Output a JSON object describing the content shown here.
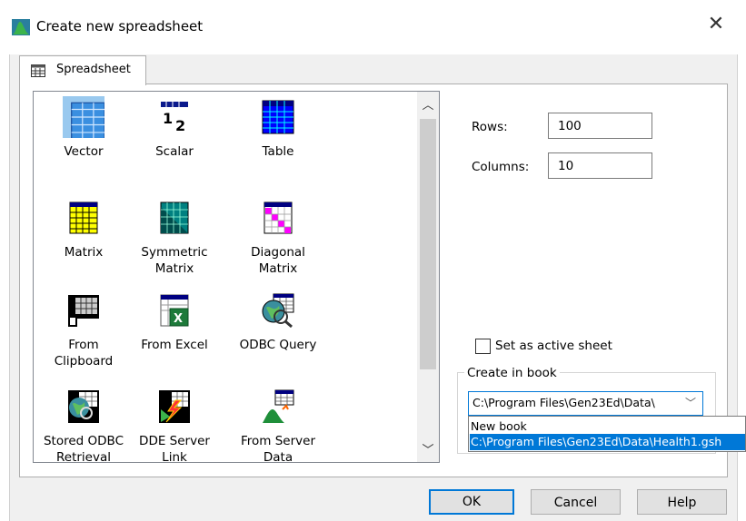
{
  "window": {
    "title": "Create new spreadsheet",
    "close_icon": "close-icon"
  },
  "tab": {
    "label": "Spreadsheet",
    "icon": "spreadsheet-grid-icon"
  },
  "types": [
    {
      "id": "vector",
      "label": "Vector",
      "icon": "vector-icon",
      "selected": true
    },
    {
      "id": "scalar",
      "label": "Scalar",
      "icon": "scalar-icon"
    },
    {
      "id": "table",
      "label": "Table",
      "icon": "table-icon"
    },
    {
      "id": "matrix",
      "label": "Matrix",
      "icon": "matrix-icon"
    },
    {
      "id": "symmetric-matrix",
      "label": "Symmetric\nMatrix",
      "icon": "symmetric-matrix-icon"
    },
    {
      "id": "diagonal-matrix",
      "label": "Diagonal\nMatrix",
      "icon": "diagonal-matrix-icon"
    },
    {
      "id": "from-clipboard",
      "label": "From\nClipboard",
      "icon": "clipboard-icon"
    },
    {
      "id": "from-excel",
      "label": "From Excel",
      "icon": "excel-icon"
    },
    {
      "id": "odbc-query",
      "label": "ODBC Query",
      "icon": "odbc-query-icon"
    },
    {
      "id": "stored-odbc",
      "label": "Stored ODBC\nRetrieval",
      "icon": "stored-odbc-icon"
    },
    {
      "id": "dde-server",
      "label": "DDE Server\nLink",
      "icon": "dde-server-icon"
    },
    {
      "id": "from-server",
      "label": "From Server\nData",
      "icon": "server-data-icon"
    }
  ],
  "rows": {
    "label": "Rows:",
    "value": "100"
  },
  "columns": {
    "label": "Columns:",
    "value": "10"
  },
  "active_sheet": {
    "label": "Set as active sheet",
    "checked": false
  },
  "create_in_book": {
    "label": "Create in book",
    "selected": "C:\\Program Files\\Gen23Ed\\Data\\Health1.gsh",
    "selected_display": "C:\\Program Files\\Gen23Ed\\Data\\",
    "options": [
      "New book",
      "C:\\Program Files\\Gen23Ed\\Data\\Health1.gsh"
    ]
  },
  "buttons": {
    "ok": "OK",
    "cancel": "Cancel",
    "help": "Help"
  },
  "colors": {
    "accent": "#0078d7",
    "selection": "#99c9ef",
    "icon_blue": "#0000ff",
    "icon_yellow": "#ffff00",
    "icon_teal": "#008080",
    "icon_magenta": "#ff00ff"
  }
}
